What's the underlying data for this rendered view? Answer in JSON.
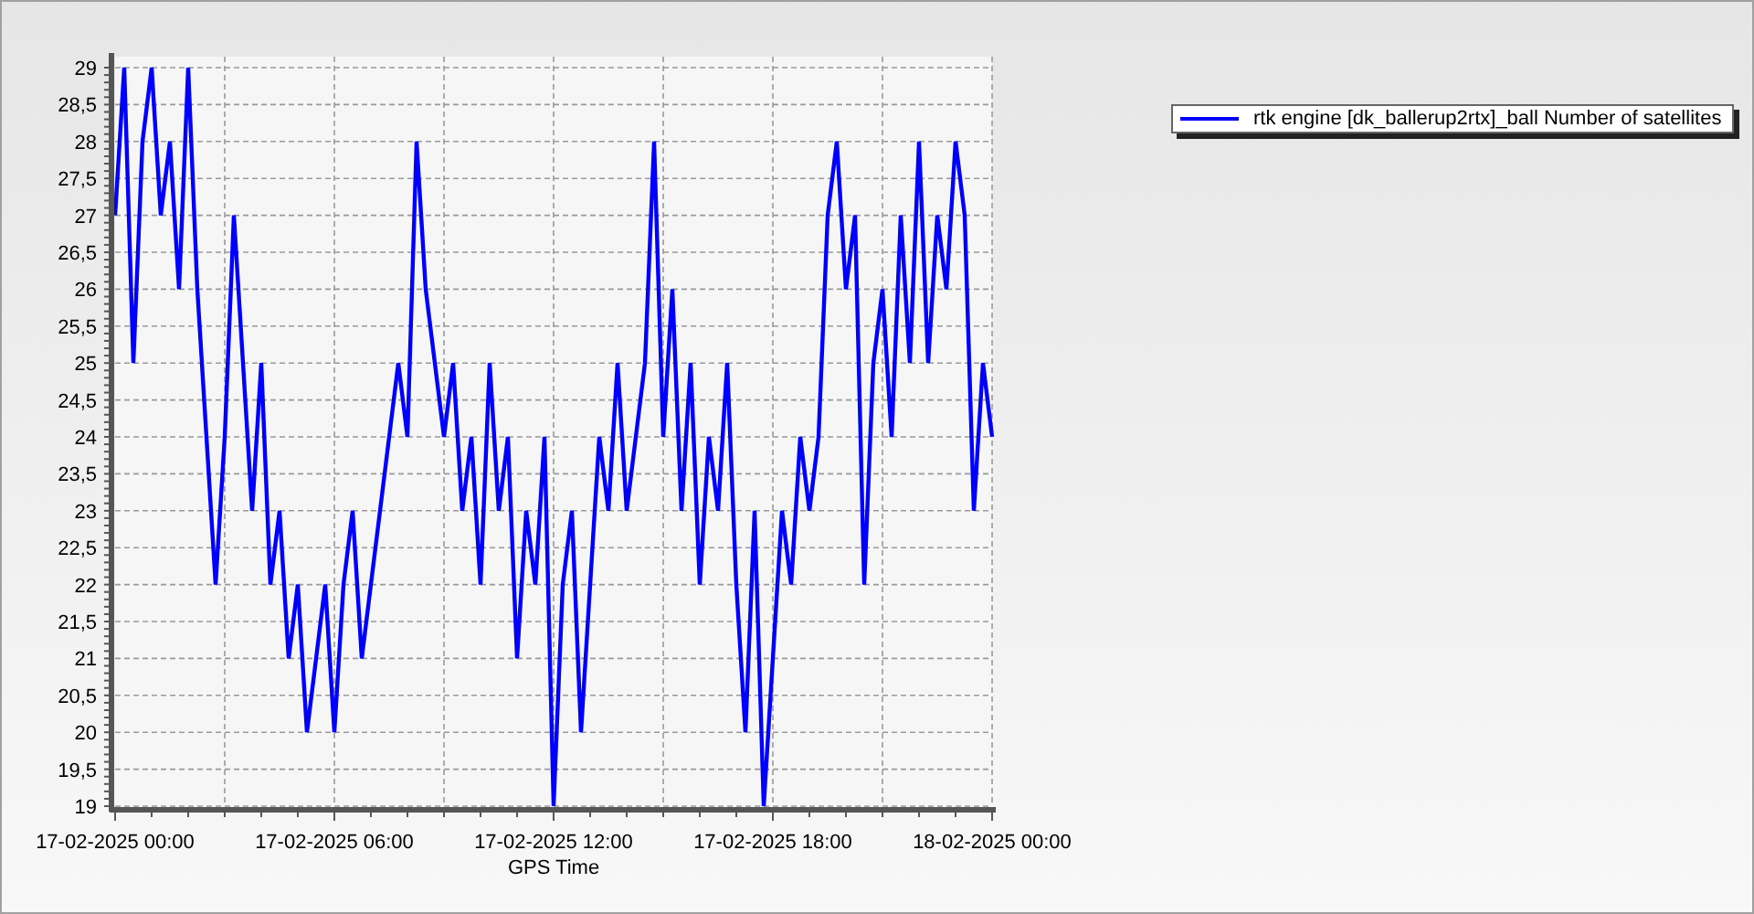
{
  "chart_data": {
    "type": "line",
    "xlabel": "GPS Time",
    "categories": [
      "17-02-2025 00:00",
      null,
      null,
      null,
      null,
      null,
      null,
      null,
      null,
      null,
      null,
      null,
      null,
      null,
      null,
      null,
      null,
      null,
      null,
      null,
      null,
      null,
      null,
      null,
      "17-02-2025 06:00",
      null,
      null,
      null,
      null,
      null,
      null,
      null,
      null,
      null,
      null,
      null,
      null,
      null,
      null,
      null,
      null,
      null,
      null,
      null,
      null,
      null,
      null,
      null,
      "17-02-2025 12:00",
      null,
      null,
      null,
      null,
      null,
      null,
      null,
      null,
      null,
      null,
      null,
      null,
      null,
      null,
      null,
      null,
      null,
      null,
      null,
      null,
      null,
      null,
      null,
      "17-02-2025 18:00",
      null,
      null,
      null,
      null,
      null,
      null,
      null,
      null,
      null,
      null,
      null,
      null,
      null,
      null,
      null,
      null,
      null,
      null,
      null,
      null,
      null,
      null,
      null,
      "18-02-2025 00:00"
    ],
    "series": [
      {
        "name": "rtk engine [dk_ballerup2rtx]_ball Number of satellites",
        "color": "#0000ff",
        "values": [
          27,
          29,
          25,
          28,
          29,
          27,
          28,
          26,
          29,
          26,
          24,
          22,
          24,
          27,
          25,
          23,
          25,
          22,
          23,
          21,
          22,
          20,
          21,
          22,
          20,
          22,
          23,
          21,
          22,
          23,
          24,
          25,
          24,
          28,
          26,
          25,
          24,
          25,
          23,
          24,
          22,
          25,
          23,
          24,
          21,
          23,
          22,
          24,
          19,
          22,
          23,
          20,
          22,
          24,
          23,
          25,
          23,
          24,
          25,
          28,
          24,
          26,
          23,
          25,
          22,
          24,
          23,
          25,
          22,
          20,
          23,
          19,
          21,
          23,
          22,
          24,
          23,
          24,
          27,
          28,
          26,
          27,
          22,
          25,
          26,
          24,
          27,
          25,
          28,
          25,
          27,
          26,
          28,
          27,
          23,
          25,
          24
        ]
      }
    ],
    "ylim": [
      19,
      29
    ],
    "grid": true,
    "yticks": [
      {
        "value": 19,
        "label": "19"
      },
      {
        "value": 19.5,
        "label": "19,5"
      },
      {
        "value": 20,
        "label": "20"
      },
      {
        "value": 20.5,
        "label": "20,5"
      },
      {
        "value": 21,
        "label": "21"
      },
      {
        "value": 21.5,
        "label": "21,5"
      },
      {
        "value": 22,
        "label": "22"
      },
      {
        "value": 22.5,
        "label": "22,5"
      },
      {
        "value": 23,
        "label": "23"
      },
      {
        "value": 23.5,
        "label": "23,5"
      },
      {
        "value": 24,
        "label": "24"
      },
      {
        "value": 24.5,
        "label": "24,5"
      },
      {
        "value": 25,
        "label": "25"
      },
      {
        "value": 25.5,
        "label": "25,5"
      },
      {
        "value": 26,
        "label": "26"
      },
      {
        "value": 26.5,
        "label": "26,5"
      },
      {
        "value": 27,
        "label": "27"
      },
      {
        "value": 27.5,
        "label": "27,5"
      },
      {
        "value": 28,
        "label": "28"
      },
      {
        "value": 28.5,
        "label": "28,5"
      },
      {
        "value": 29,
        "label": "29"
      }
    ]
  }
}
